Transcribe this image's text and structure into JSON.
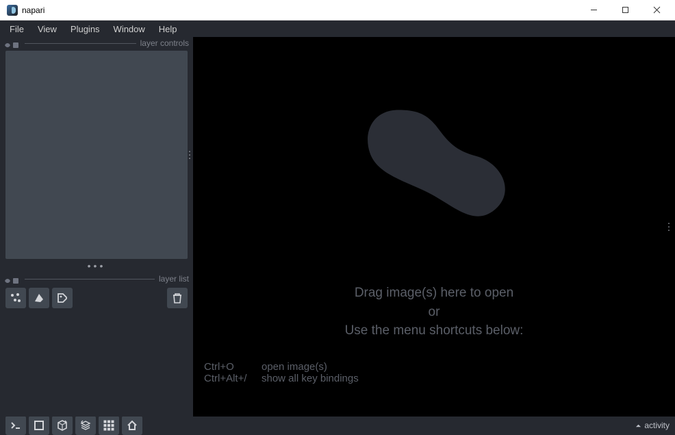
{
  "window": {
    "title": "napari"
  },
  "menubar": {
    "items": [
      "File",
      "View",
      "Plugins",
      "Window",
      "Help"
    ]
  },
  "panels": {
    "layer_controls_label": "layer controls",
    "layer_list_label": "layer list"
  },
  "layer_tools": {
    "points": "new-points-layer",
    "shapes": "new-shapes-layer",
    "labels": "new-labels-layer",
    "delete": "delete-layer"
  },
  "welcome": {
    "line1": "Drag image(s) here to open",
    "line2": "or",
    "line3": "Use the menu shortcuts below:"
  },
  "shortcuts": [
    {
      "key": "Ctrl+O",
      "desc": "open image(s)"
    },
    {
      "key": "Ctrl+Alt+/",
      "desc": "show all key bindings"
    }
  ],
  "viewer_buttons": {
    "console": "toggle-console",
    "ndisplay": "toggle-2d-3d",
    "roll": "roll-dimensions",
    "transpose": "transpose-dimensions",
    "grid": "toggle-grid",
    "home": "reset-view"
  },
  "status": {
    "activity_label": "activity"
  }
}
